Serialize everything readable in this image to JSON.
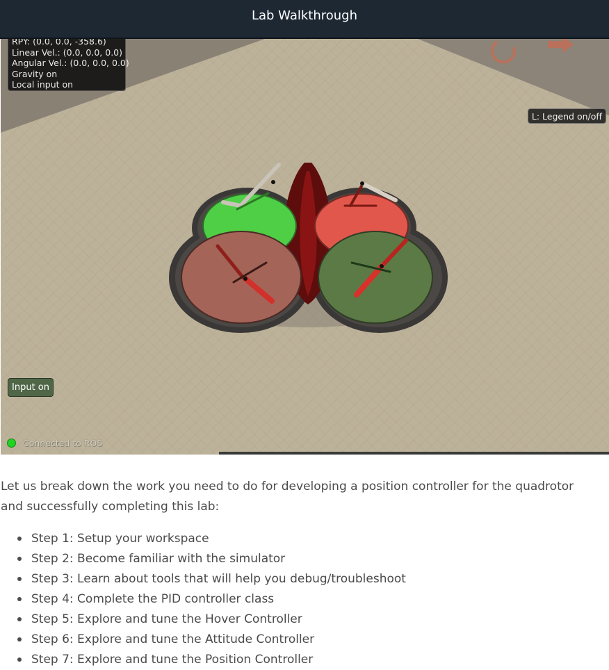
{
  "header": {
    "title": "Lab Walkthrough"
  },
  "simulator": {
    "stats": {
      "rpy": "RPY: (0.0, 0.0, -358.6)",
      "linear_vel": "Linear Vel.: (0.0, 0.0, 0.0)",
      "angular_vel": "Angular Vel.: (0.0, 0.0, 0.0)",
      "gravity": "Gravity on",
      "local_input": "Local input on"
    },
    "legend_button": "L: Legend on/off",
    "input_button": "Input on",
    "ros_status": "Connected to ROS",
    "ros_status_color": "#22d422",
    "icons": [
      "reset-icon",
      "arrow-right-icon"
    ]
  },
  "content": {
    "intro": "Let us break down the work you need to do for developing a position controller for the quadrotor and successfully completing this lab:",
    "steps": [
      "Step 1: Setup your workspace",
      "Step 2: Become familiar with the simulator",
      "Step 3: Learn about tools that will help you debug/troubleshoot",
      "Step 4: Complete the PID controller class",
      "Step 5: Explore and tune the Hover Controller",
      "Step 6: Explore and tune the Attitude Controller",
      "Step 7: Explore and tune the Position Controller"
    ]
  },
  "colors": {
    "header_bg": "#1d2833",
    "rotor_green": "#4fcf45",
    "rotor_red": "#e2574c",
    "rotor_dark_red": "#a46458",
    "rotor_dark_green": "#5c7a46"
  }
}
